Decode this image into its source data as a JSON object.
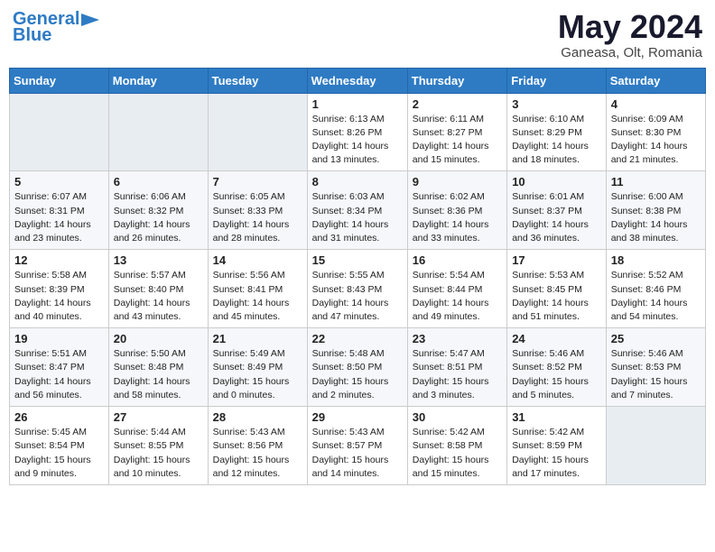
{
  "header": {
    "logo_line1": "General",
    "logo_line2": "Blue",
    "month": "May 2024",
    "location": "Ganeasa, Olt, Romania"
  },
  "weekdays": [
    "Sunday",
    "Monday",
    "Tuesday",
    "Wednesday",
    "Thursday",
    "Friday",
    "Saturday"
  ],
  "weeks": [
    [
      {
        "day": "",
        "info": ""
      },
      {
        "day": "",
        "info": ""
      },
      {
        "day": "",
        "info": ""
      },
      {
        "day": "1",
        "info": "Sunrise: 6:13 AM\nSunset: 8:26 PM\nDaylight: 14 hours\nand 13 minutes."
      },
      {
        "day": "2",
        "info": "Sunrise: 6:11 AM\nSunset: 8:27 PM\nDaylight: 14 hours\nand 15 minutes."
      },
      {
        "day": "3",
        "info": "Sunrise: 6:10 AM\nSunset: 8:29 PM\nDaylight: 14 hours\nand 18 minutes."
      },
      {
        "day": "4",
        "info": "Sunrise: 6:09 AM\nSunset: 8:30 PM\nDaylight: 14 hours\nand 21 minutes."
      }
    ],
    [
      {
        "day": "5",
        "info": "Sunrise: 6:07 AM\nSunset: 8:31 PM\nDaylight: 14 hours\nand 23 minutes."
      },
      {
        "day": "6",
        "info": "Sunrise: 6:06 AM\nSunset: 8:32 PM\nDaylight: 14 hours\nand 26 minutes."
      },
      {
        "day": "7",
        "info": "Sunrise: 6:05 AM\nSunset: 8:33 PM\nDaylight: 14 hours\nand 28 minutes."
      },
      {
        "day": "8",
        "info": "Sunrise: 6:03 AM\nSunset: 8:34 PM\nDaylight: 14 hours\nand 31 minutes."
      },
      {
        "day": "9",
        "info": "Sunrise: 6:02 AM\nSunset: 8:36 PM\nDaylight: 14 hours\nand 33 minutes."
      },
      {
        "day": "10",
        "info": "Sunrise: 6:01 AM\nSunset: 8:37 PM\nDaylight: 14 hours\nand 36 minutes."
      },
      {
        "day": "11",
        "info": "Sunrise: 6:00 AM\nSunset: 8:38 PM\nDaylight: 14 hours\nand 38 minutes."
      }
    ],
    [
      {
        "day": "12",
        "info": "Sunrise: 5:58 AM\nSunset: 8:39 PM\nDaylight: 14 hours\nand 40 minutes."
      },
      {
        "day": "13",
        "info": "Sunrise: 5:57 AM\nSunset: 8:40 PM\nDaylight: 14 hours\nand 43 minutes."
      },
      {
        "day": "14",
        "info": "Sunrise: 5:56 AM\nSunset: 8:41 PM\nDaylight: 14 hours\nand 45 minutes."
      },
      {
        "day": "15",
        "info": "Sunrise: 5:55 AM\nSunset: 8:43 PM\nDaylight: 14 hours\nand 47 minutes."
      },
      {
        "day": "16",
        "info": "Sunrise: 5:54 AM\nSunset: 8:44 PM\nDaylight: 14 hours\nand 49 minutes."
      },
      {
        "day": "17",
        "info": "Sunrise: 5:53 AM\nSunset: 8:45 PM\nDaylight: 14 hours\nand 51 minutes."
      },
      {
        "day": "18",
        "info": "Sunrise: 5:52 AM\nSunset: 8:46 PM\nDaylight: 14 hours\nand 54 minutes."
      }
    ],
    [
      {
        "day": "19",
        "info": "Sunrise: 5:51 AM\nSunset: 8:47 PM\nDaylight: 14 hours\nand 56 minutes."
      },
      {
        "day": "20",
        "info": "Sunrise: 5:50 AM\nSunset: 8:48 PM\nDaylight: 14 hours\nand 58 minutes."
      },
      {
        "day": "21",
        "info": "Sunrise: 5:49 AM\nSunset: 8:49 PM\nDaylight: 15 hours\nand 0 minutes."
      },
      {
        "day": "22",
        "info": "Sunrise: 5:48 AM\nSunset: 8:50 PM\nDaylight: 15 hours\nand 2 minutes."
      },
      {
        "day": "23",
        "info": "Sunrise: 5:47 AM\nSunset: 8:51 PM\nDaylight: 15 hours\nand 3 minutes."
      },
      {
        "day": "24",
        "info": "Sunrise: 5:46 AM\nSunset: 8:52 PM\nDaylight: 15 hours\nand 5 minutes."
      },
      {
        "day": "25",
        "info": "Sunrise: 5:46 AM\nSunset: 8:53 PM\nDaylight: 15 hours\nand 7 minutes."
      }
    ],
    [
      {
        "day": "26",
        "info": "Sunrise: 5:45 AM\nSunset: 8:54 PM\nDaylight: 15 hours\nand 9 minutes."
      },
      {
        "day": "27",
        "info": "Sunrise: 5:44 AM\nSunset: 8:55 PM\nDaylight: 15 hours\nand 10 minutes."
      },
      {
        "day": "28",
        "info": "Sunrise: 5:43 AM\nSunset: 8:56 PM\nDaylight: 15 hours\nand 12 minutes."
      },
      {
        "day": "29",
        "info": "Sunrise: 5:43 AM\nSunset: 8:57 PM\nDaylight: 15 hours\nand 14 minutes."
      },
      {
        "day": "30",
        "info": "Sunrise: 5:42 AM\nSunset: 8:58 PM\nDaylight: 15 hours\nand 15 minutes."
      },
      {
        "day": "31",
        "info": "Sunrise: 5:42 AM\nSunset: 8:59 PM\nDaylight: 15 hours\nand 17 minutes."
      },
      {
        "day": "",
        "info": ""
      }
    ]
  ]
}
